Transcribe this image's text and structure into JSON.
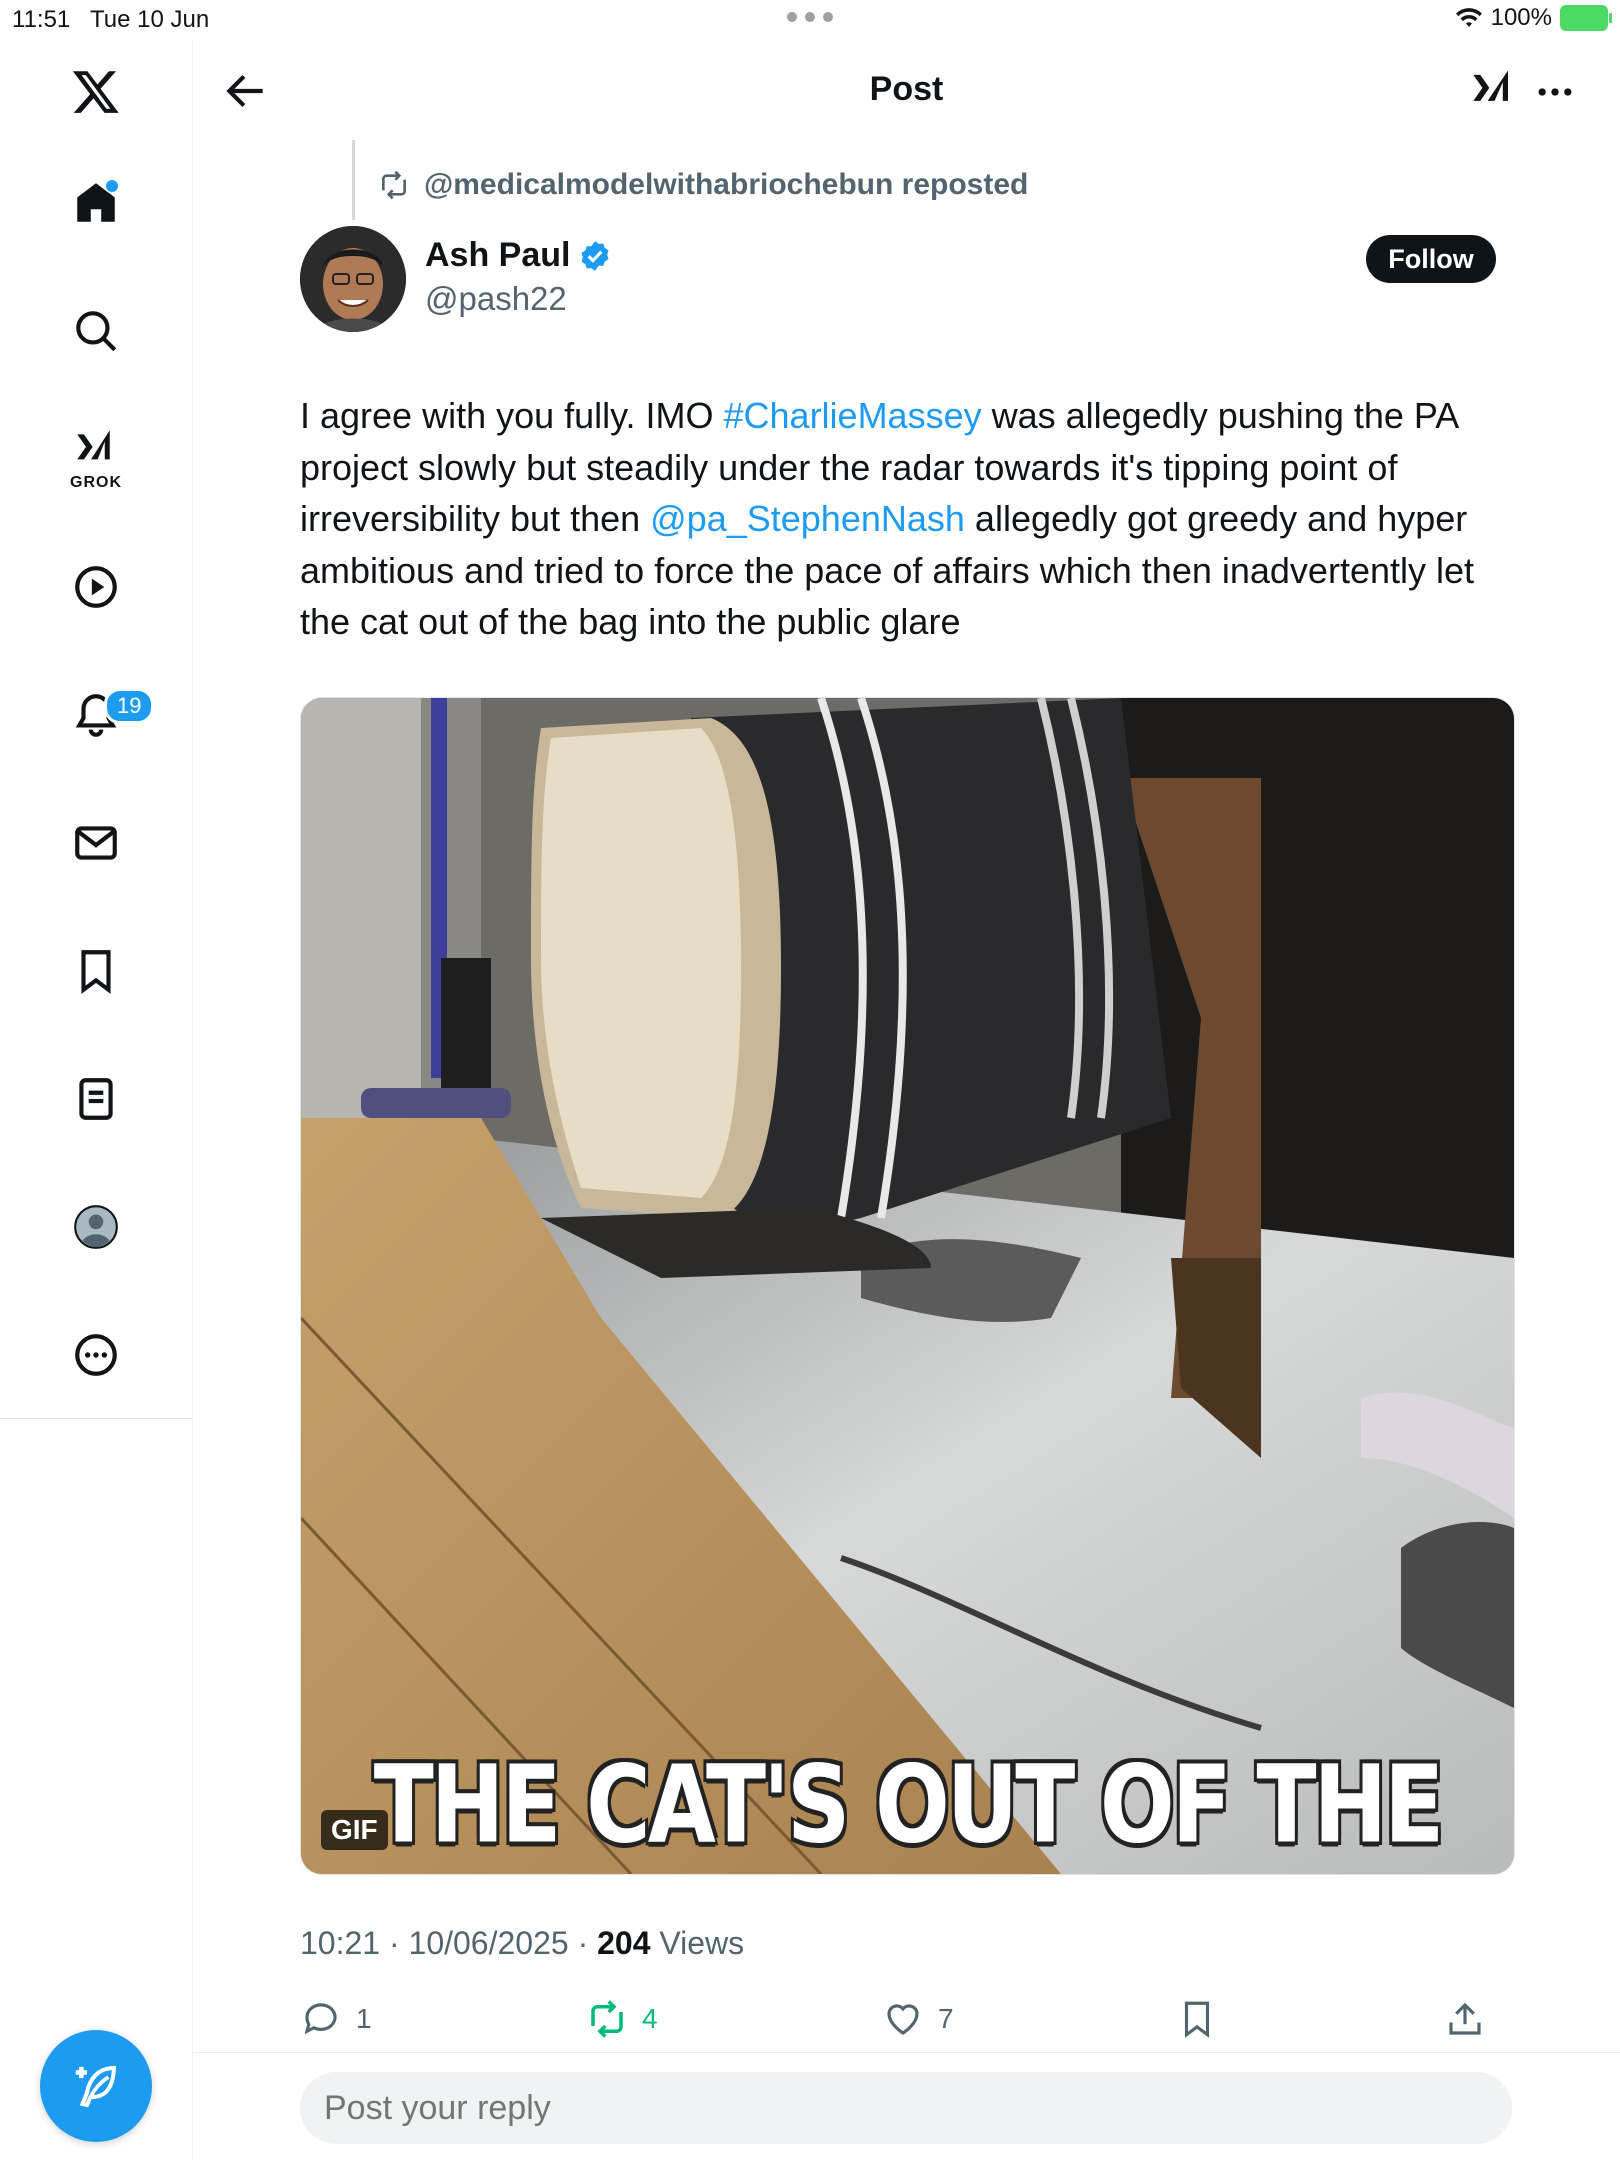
{
  "status_bar": {
    "time": "11:51",
    "date": "Tue 10 Jun",
    "battery": "100%"
  },
  "sidebar": {
    "items": [
      {
        "name": "home",
        "icon": "home-icon"
      },
      {
        "name": "explore",
        "icon": "search-icon"
      },
      {
        "name": "grok",
        "icon": "grok-icon",
        "label": "GROK"
      },
      {
        "name": "videos",
        "icon": "play-icon"
      },
      {
        "name": "notifications",
        "icon": "bell-icon",
        "badge": "19"
      },
      {
        "name": "messages",
        "icon": "mail-icon"
      },
      {
        "name": "bookmarks",
        "icon": "bookmark-icon"
      },
      {
        "name": "lists",
        "icon": "list-icon"
      },
      {
        "name": "profile",
        "icon": "profile-icon"
      },
      {
        "name": "more",
        "icon": "more-icon"
      }
    ],
    "compose_icon": "compose-icon"
  },
  "header": {
    "title": "Post"
  },
  "post": {
    "repost_label": "@medicalmodelwithabriochebun reposted",
    "author_name": "Ash Paul",
    "author_handle": "@pash22",
    "follow_label": "Follow",
    "text_parts": {
      "p1": "I agree with you fully. IMO ",
      "hashtag": "#CharlieMassey",
      "p2": " was allegedly pushing the PA project slowly but steadily under the radar towards it's tipping point of irreversibility but then ",
      "mention": "@pa_StephenNash",
      "p3": " allegedly got greedy and hyper ambitious and tried to force the pace of affairs which then inadvertently let the cat out of the bag into the public glare"
    },
    "media": {
      "type": "GIF",
      "gif_label": "GIF",
      "caption": "THE CAT'S OUT OF THE BAG"
    },
    "meta": {
      "time": "10:21",
      "date": "10/06/2025",
      "views_count": "204",
      "views_label": "Views",
      "sep": "·"
    },
    "actions": {
      "replies": "1",
      "reposts": "4",
      "likes": "7"
    },
    "reply_placeholder": "Post your reply"
  },
  "colors": {
    "accent": "#1d9bf0",
    "repost_green": "#00ba7c",
    "text": "#0f1419",
    "secondary": "#536471"
  }
}
